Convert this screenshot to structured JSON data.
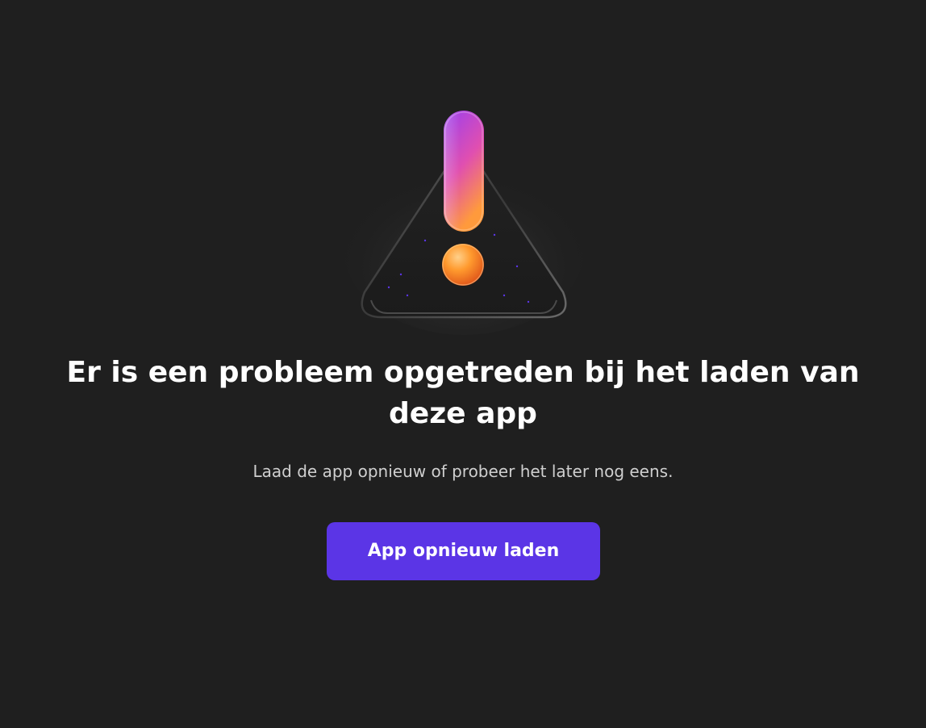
{
  "error": {
    "icon": "warning-triangle-icon",
    "title": "Er is een probleem opgetreden bij het laden van deze app",
    "message": "Laad de app opnieuw of probeer het later nog eens.",
    "reload_label": "App opnieuw laden"
  },
  "colors": {
    "background": "#1f1f1f",
    "accent": "#5b35e6",
    "title_text": "#ffffff",
    "message_text": "#cfcfcf"
  }
}
